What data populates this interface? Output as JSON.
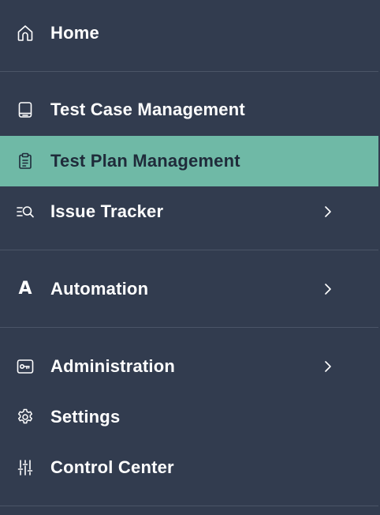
{
  "sidebar": {
    "items": [
      {
        "label": "Home",
        "icon": "home-icon"
      },
      {
        "label": "Test Case Management",
        "icon": "test-case-icon"
      },
      {
        "label": "Test Plan Management",
        "icon": "clipboard-icon",
        "active": true
      },
      {
        "label": "Issue Tracker",
        "icon": "issue-search-icon",
        "has_submenu": true
      },
      {
        "label": "Automation",
        "icon": "automation-icon",
        "icon_text": "A",
        "has_submenu": true
      },
      {
        "label": "Administration",
        "icon": "key-icon",
        "has_submenu": true
      },
      {
        "label": "Settings",
        "icon": "gear-icon"
      },
      {
        "label": "Control Center",
        "icon": "sliders-icon"
      }
    ]
  },
  "colors": {
    "background": "#323c4f",
    "active_background": "#6fb9a6",
    "active_text": "#1f2b3a",
    "text": "#ffffff",
    "divider": "#4b5567"
  }
}
